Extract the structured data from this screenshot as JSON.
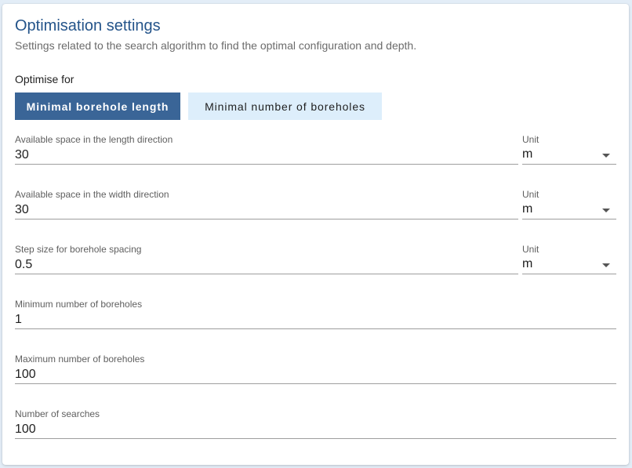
{
  "header": {
    "title": "Optimisation settings",
    "subtitle": "Settings related to the search algorithm to find the optimal configuration and depth."
  },
  "optimise_for": {
    "label": "Optimise for",
    "options": [
      "Minimal borehole length",
      "Minimal number of boreholes"
    ],
    "selected": "Minimal borehole length"
  },
  "fields": {
    "length": {
      "label": "Available space in the length direction",
      "value": "30",
      "unit_label": "Unit",
      "unit": "m"
    },
    "width": {
      "label": "Available space in the width direction",
      "value": "30",
      "unit_label": "Unit",
      "unit": "m"
    },
    "step": {
      "label": "Step size for borehole spacing",
      "value": "0.5",
      "unit_label": "Unit",
      "unit": "m"
    },
    "min_boreholes": {
      "label": "Minimum number of boreholes",
      "value": "1"
    },
    "max_boreholes": {
      "label": "Maximum number of boreholes",
      "value": "100"
    },
    "searches": {
      "label": "Number of searches",
      "value": "100"
    }
  },
  "colors": {
    "accent": "#3a6597",
    "title": "#24548a",
    "inactive_toggle": "#ddeefb",
    "background": "#e3edf7"
  },
  "icons": {
    "dropdown": "chevron-down-icon"
  }
}
